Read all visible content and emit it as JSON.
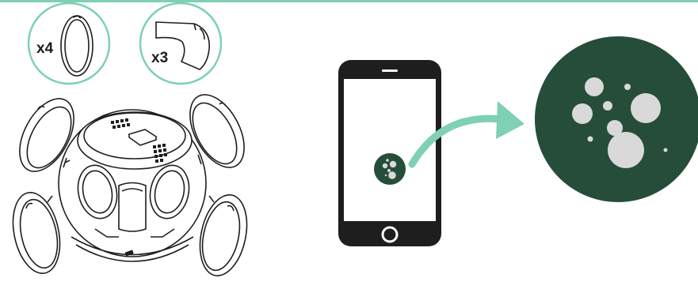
{
  "parts": {
    "ring_quantity": "x4",
    "clip_quantity": "x3"
  },
  "colors": {
    "accent": "#7fd0b4",
    "brand_dark": "#264d3a",
    "bubble": "#d9d9d9",
    "line": "#1e1e1e"
  },
  "icons": [
    "ring-part-icon",
    "clip-part-icon",
    "sphere-device-icon",
    "smartphone-icon",
    "app-logo-icon",
    "transfer-arrow-icon"
  ]
}
